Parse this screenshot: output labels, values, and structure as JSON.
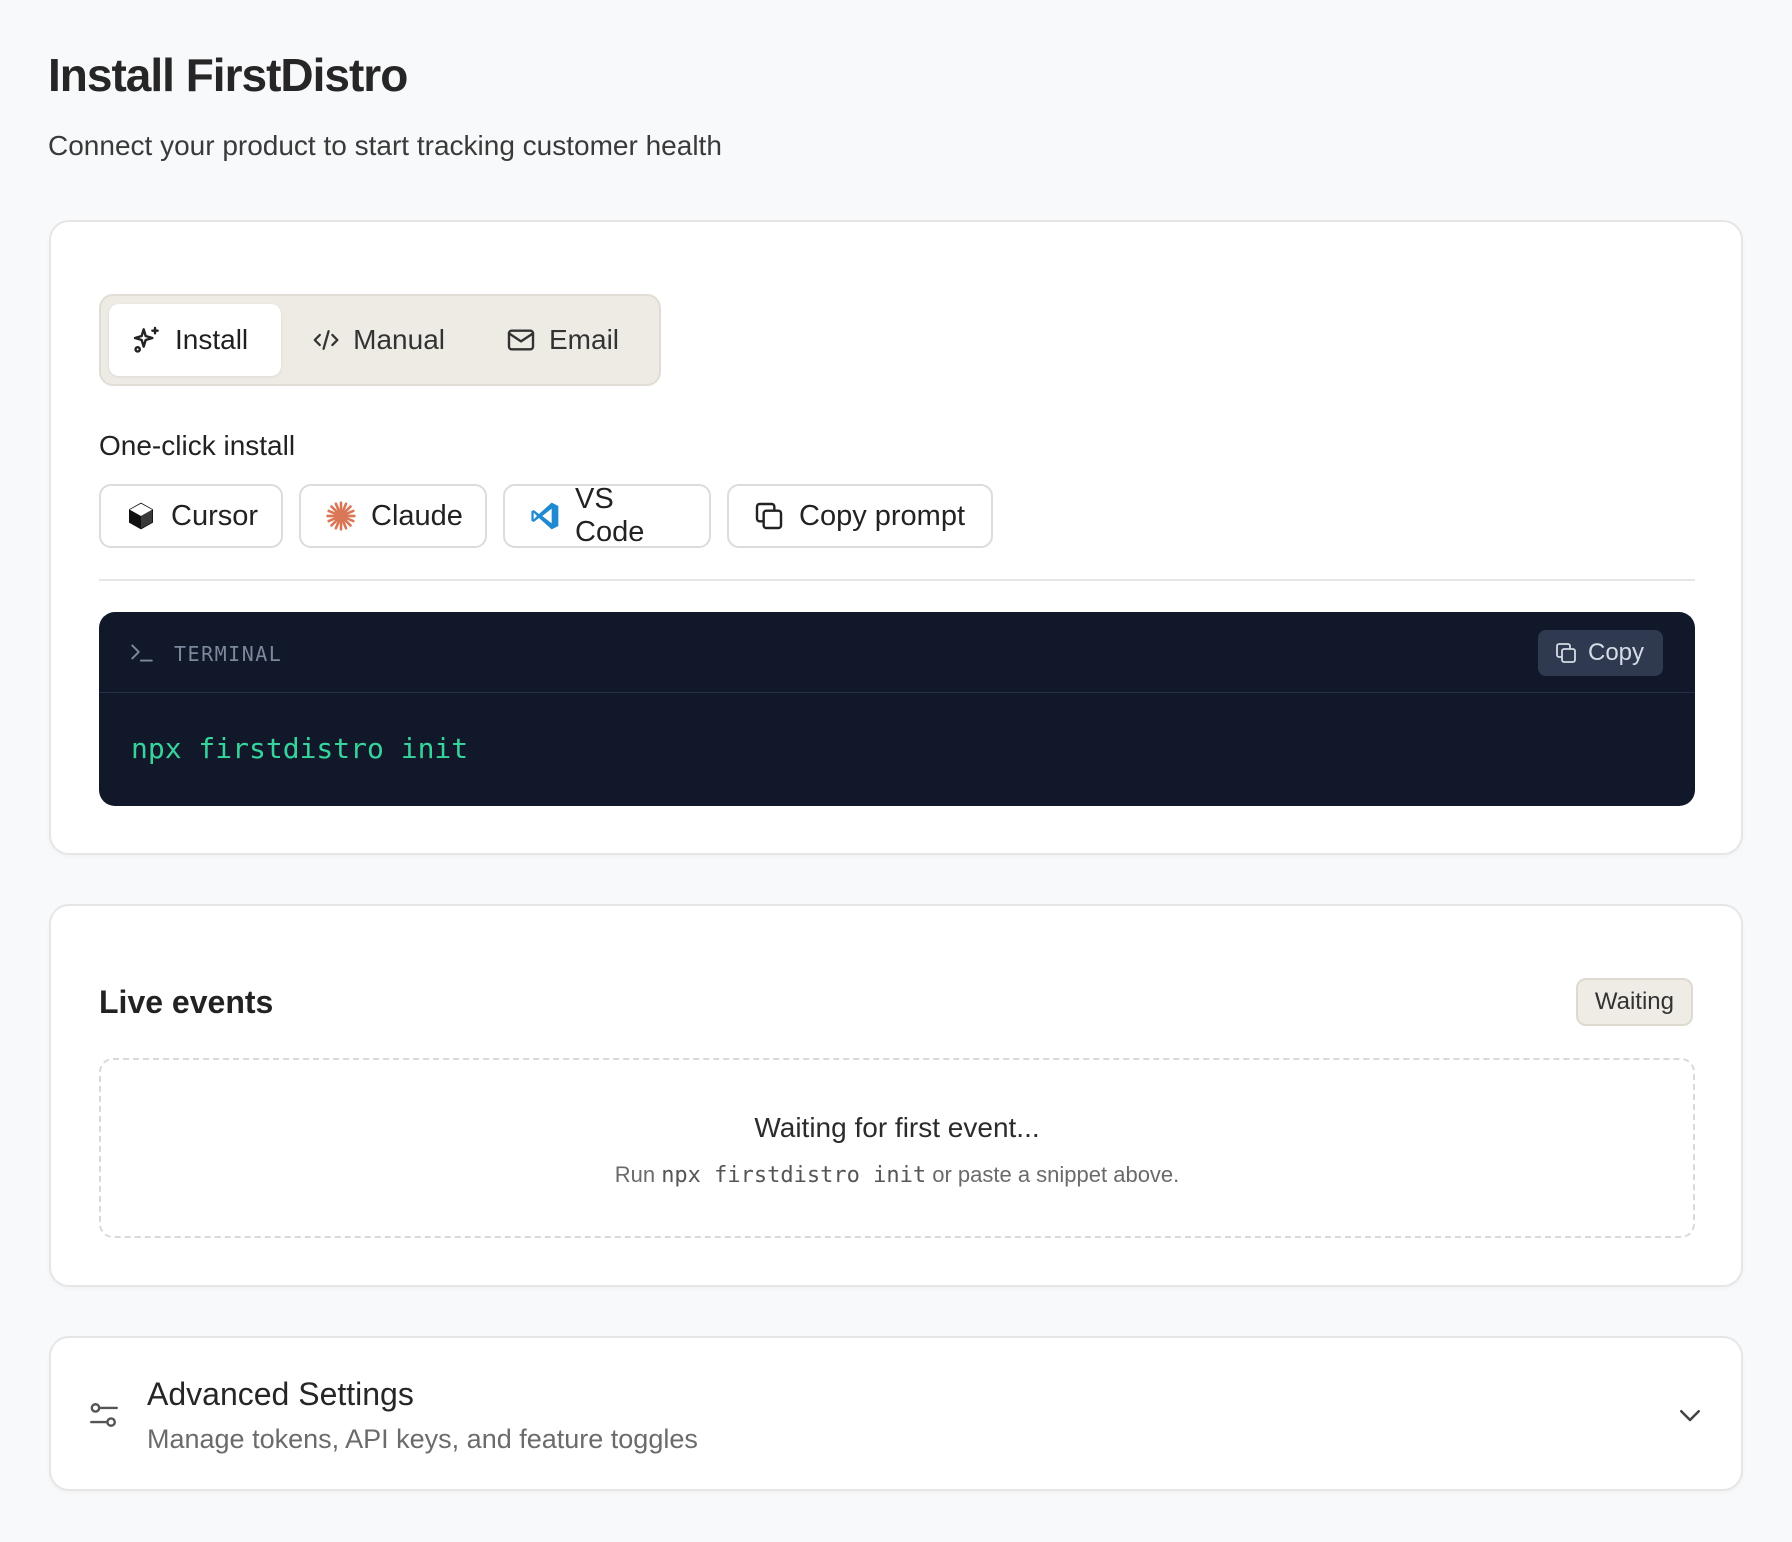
{
  "header": {
    "title": "Install FirstDistro",
    "subtitle": "Connect your product to start tracking customer health"
  },
  "install_card": {
    "tabs": [
      {
        "label": "Install",
        "icon": "sparkles-icon",
        "active": true
      },
      {
        "label": "Manual",
        "icon": "code-icon",
        "active": false
      },
      {
        "label": "Email",
        "icon": "mail-icon",
        "active": false
      }
    ],
    "oneclick_label": "One-click install",
    "buttons": [
      {
        "label": "Cursor",
        "icon": "cursor-logo-icon"
      },
      {
        "label": "Claude",
        "icon": "claude-logo-icon"
      },
      {
        "label": "VS Code",
        "icon": "vscode-logo-icon"
      },
      {
        "label": "Copy prompt",
        "icon": "copy-icon"
      }
    ],
    "terminal": {
      "label": "TERMINAL",
      "copy_label": "Copy",
      "command": "npx firstdistro init"
    }
  },
  "live_events": {
    "title": "Live events",
    "status_badge": "Waiting",
    "empty_title": "Waiting for first event...",
    "empty_sub_prefix": "Run",
    "empty_sub_code": "npx firstdistro init",
    "empty_sub_suffix": "or paste a snippet above."
  },
  "advanced": {
    "title": "Advanced Settings",
    "subtitle": "Manage tokens, API keys, and feature toggles"
  },
  "colors": {
    "terminal_bg": "#101829",
    "command_green": "#37d39c",
    "claude_orange": "#d97757",
    "vscode_blue": "#1f8ad2"
  }
}
